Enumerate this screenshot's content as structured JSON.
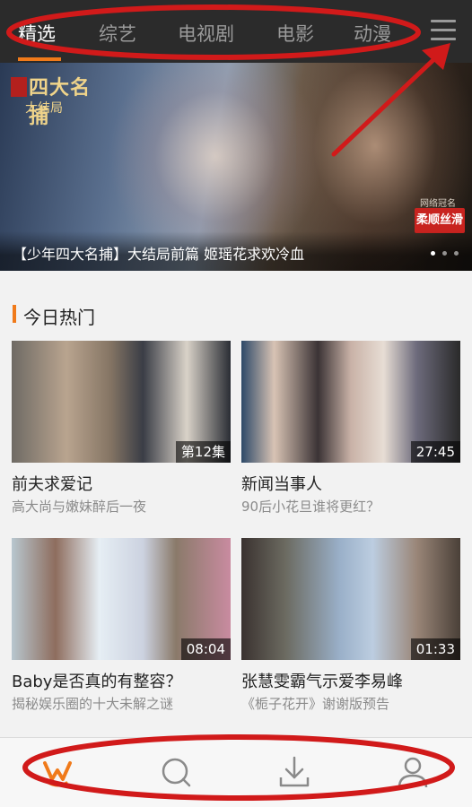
{
  "nav": {
    "tabs": [
      {
        "label": "精选"
      },
      {
        "label": "综艺"
      },
      {
        "label": "电视剧"
      },
      {
        "label": "电影"
      },
      {
        "label": "动漫"
      }
    ],
    "menu_icon": "hamburger-menu-icon",
    "accent_color": "#f07a1a"
  },
  "banner": {
    "logo_text": "四大名捕",
    "logo_sub": "大结局",
    "stamp_title": "网络冠名",
    "stamp_text": "柔顺丝滑",
    "caption": "【少年四大名捕】大结局前篇 姬瑶花求欢冷血",
    "pager": {
      "count": 3,
      "active": 0
    }
  },
  "section": {
    "title": "今日热门"
  },
  "cards": [
    {
      "badge": "第12集",
      "title": "前夫求爱记",
      "subtitle": "高大尚与嫩妹醉后一夜"
    },
    {
      "badge": "27:45",
      "title": "新闻当事人",
      "subtitle": "90后小花旦谁将更红？"
    },
    {
      "badge": "08:04",
      "title": "Baby是否真的有整容？",
      "subtitle": "揭秘娱乐圈的十大未解之谜"
    },
    {
      "badge": "01:33",
      "title": "张慧雯霸气示爱李易峰",
      "subtitle": "《栀子花开》谢谢版预告"
    }
  ],
  "bottom_nav": [
    {
      "icon": "home-logo-icon",
      "active": true
    },
    {
      "icon": "search-icon",
      "active": false
    },
    {
      "icon": "download-icon",
      "active": false
    },
    {
      "icon": "user-icon",
      "active": false
    }
  ]
}
